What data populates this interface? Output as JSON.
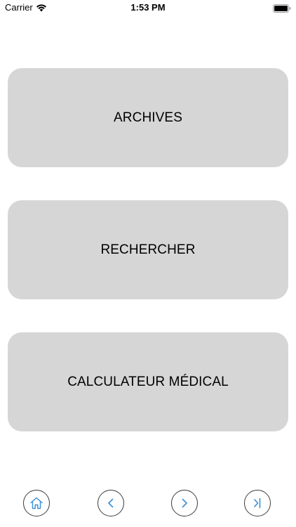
{
  "status_bar": {
    "carrier": "Carrier",
    "time": "1:53 PM"
  },
  "menu": {
    "buttons": [
      {
        "label": "ARCHIVES"
      },
      {
        "label": "RECHERCHER"
      },
      {
        "label": "CALCULATEUR MÉDICAL"
      }
    ]
  },
  "toolbar": {
    "icons": [
      "home-icon",
      "chevron-left-icon",
      "chevron-right-icon",
      "skip-to-end-icon"
    ],
    "icon_color": "#3a8fd6",
    "border_color": "#3d3d3d"
  },
  "colors": {
    "button_bg": "#d6d6d6",
    "background": "#ffffff"
  }
}
